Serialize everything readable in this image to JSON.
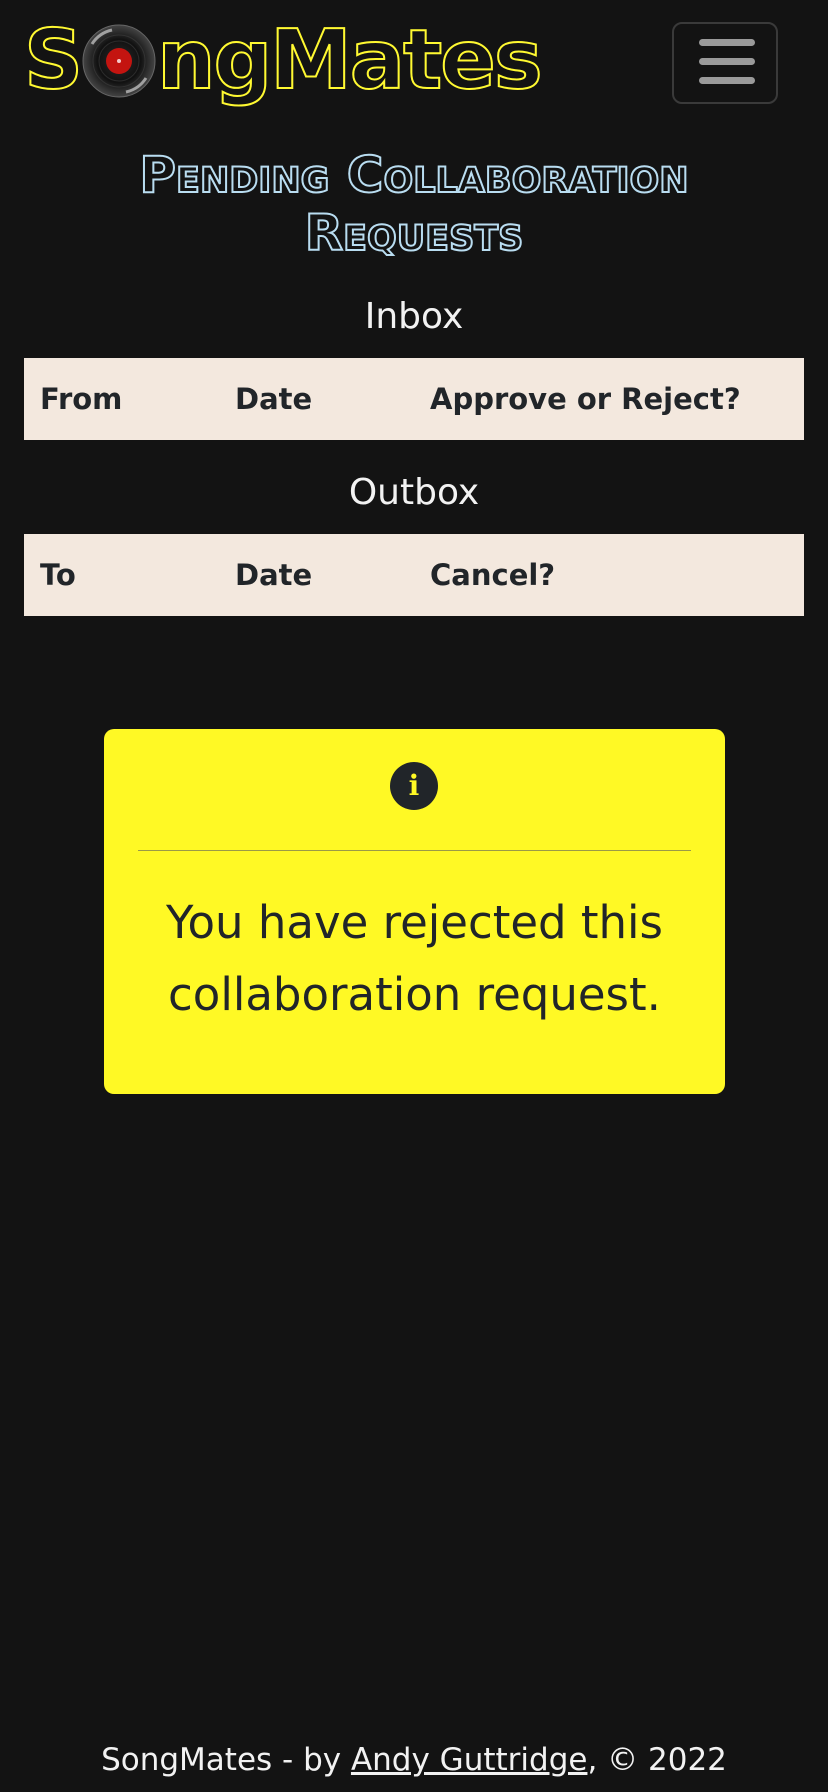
{
  "navbar": {
    "logo_part1": "S",
    "logo_part2": "ngMates",
    "menu_icon": "hamburger-menu-icon"
  },
  "page": {
    "title_line1": "Pending Collaboration",
    "title_line2": "Requests"
  },
  "inbox": {
    "heading": "Inbox",
    "columns": [
      "From",
      "Date",
      "Approve or Reject?"
    ]
  },
  "outbox": {
    "heading": "Outbox",
    "columns": [
      "To",
      "Date",
      "Cancel?"
    ]
  },
  "alert": {
    "icon": "info-icon",
    "icon_glyph": "i",
    "message": "You have rejected this collaboration request.",
    "color": "#fff925"
  },
  "footer": {
    "prefix": "SongMates - by ",
    "author_link": "Andy Guttridge",
    "suffix": ", © 2022"
  },
  "colors": {
    "background": "#131313",
    "brand_yellow": "#fff931",
    "title_blue": "#b9ddf1",
    "table_header": "#f3e8de"
  }
}
